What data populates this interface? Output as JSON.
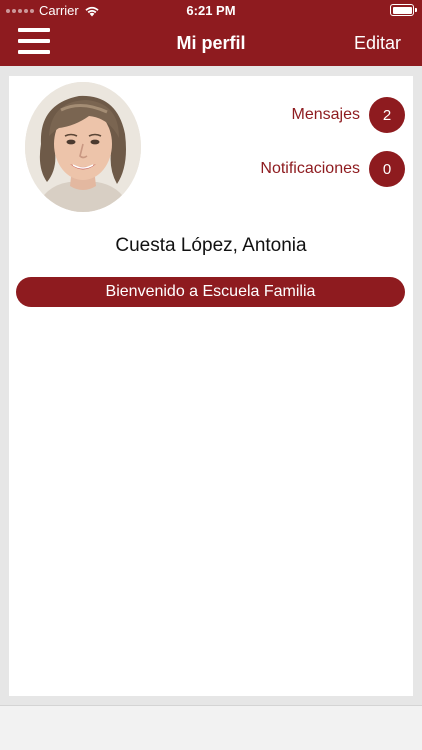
{
  "status_bar": {
    "carrier": "Carrier",
    "time": "6:21 PM"
  },
  "nav": {
    "title": "Mi perfil",
    "edit_label": "Editar",
    "menu_icon": "hamburger-menu-icon"
  },
  "profile": {
    "name": "Cuesta López, Antonia",
    "welcome": "Bienvenido a Escuela Familia"
  },
  "stats": [
    {
      "label": "Mensajes",
      "count": "2"
    },
    {
      "label": "Notificaciones",
      "count": "0"
    }
  ],
  "colors": {
    "brand": "#8e1b1f",
    "background": "#e6e6e6",
    "card": "#ffffff"
  }
}
